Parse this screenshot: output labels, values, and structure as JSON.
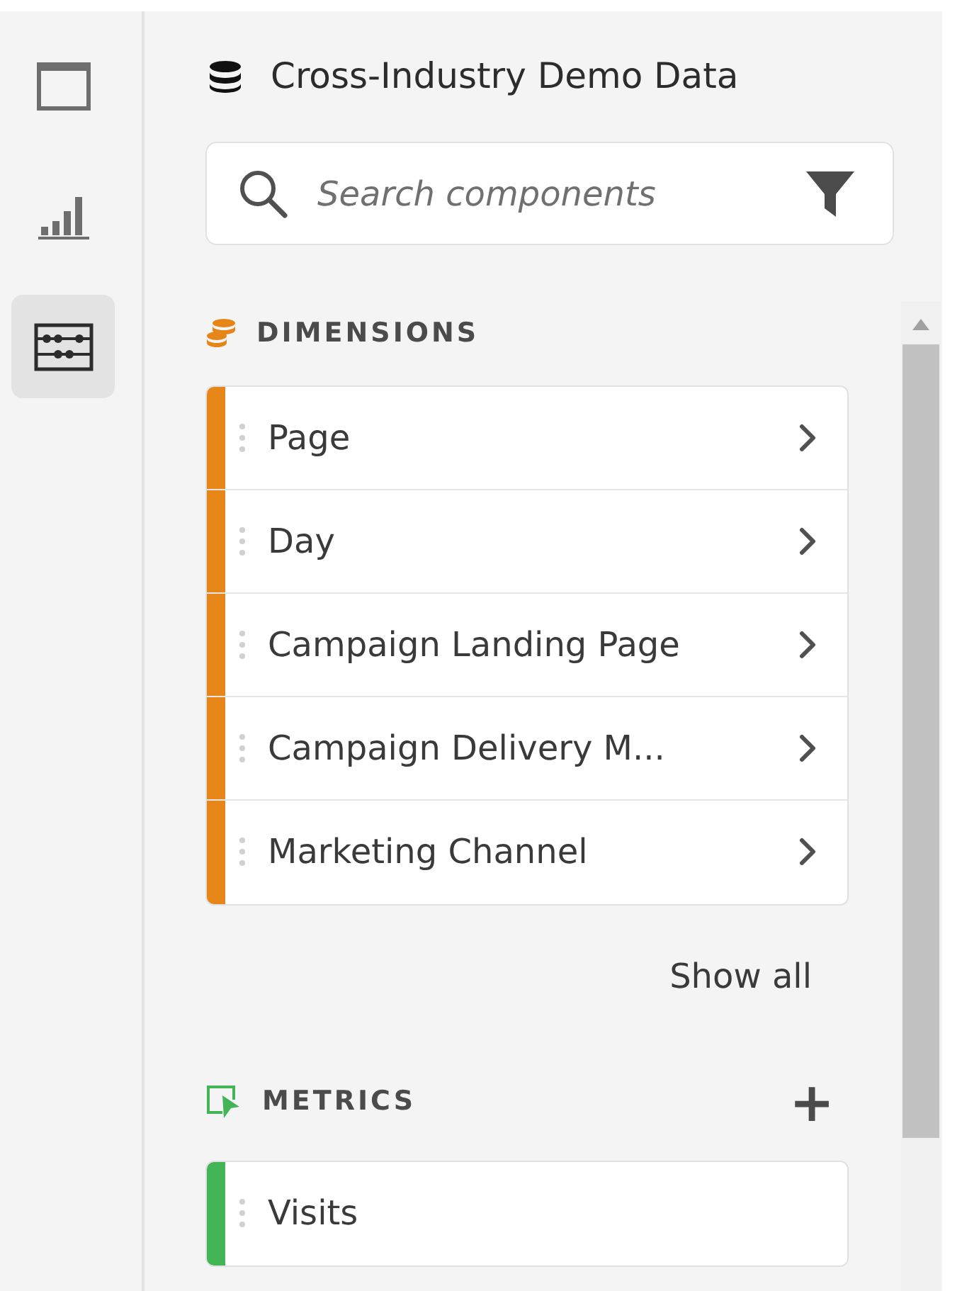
{
  "rail": [
    {
      "kind": "panel",
      "selected": false
    },
    {
      "kind": "visualization",
      "selected": false
    },
    {
      "kind": "components",
      "selected": true
    }
  ],
  "dataset": {
    "title": "Cross-Industry Demo Data"
  },
  "search": {
    "placeholder": "Search components"
  },
  "sections": [
    {
      "kind": "dimensions",
      "title": "DIMENSIONS",
      "color": "#e68619",
      "items": [
        {
          "label": "Page"
        },
        {
          "label": "Day"
        },
        {
          "label": "Campaign Landing Page"
        },
        {
          "label": "Campaign Delivery M..."
        },
        {
          "label": "Marketing Channel"
        }
      ],
      "show_all": "Show all"
    },
    {
      "kind": "metrics",
      "title": "METRICS",
      "color": "#44b556",
      "add": "+",
      "items": [
        {
          "label": "Visits"
        }
      ]
    }
  ]
}
